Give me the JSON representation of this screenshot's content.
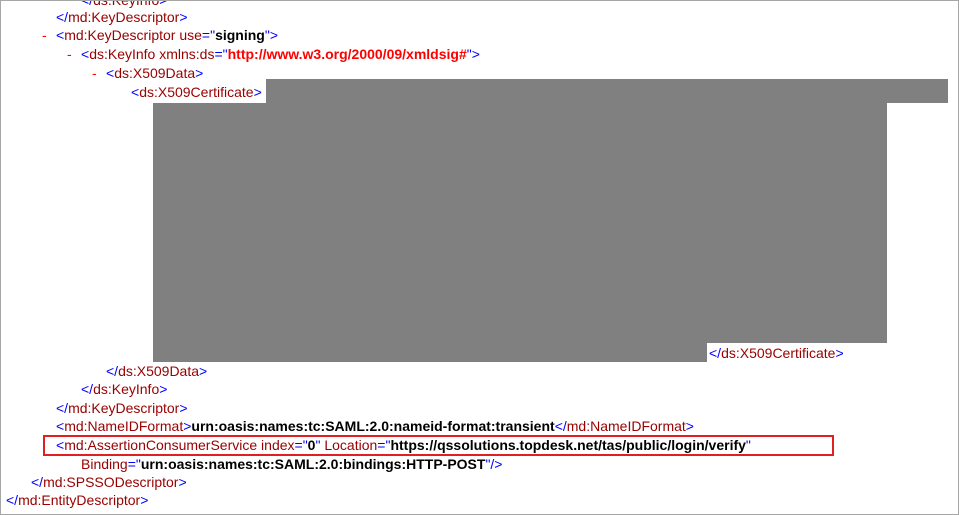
{
  "xml": {
    "lines": {
      "l0": {
        "close_tag": "ds:KeyInfo"
      },
      "l1": {
        "close_tag": "md:KeyDescriptor"
      },
      "l2": {
        "toggle": "-",
        "tag": "md:KeyDescriptor",
        "attr_name": "use",
        "attr_value": "signing"
      },
      "l3": {
        "toggle": "-",
        "tag": "ds:KeyInfo",
        "attr_name": "xmlns:ds",
        "attr_value": "http://www.w3.org/2000/09/xmldsig#"
      },
      "l4": {
        "toggle": "-",
        "tag": "ds:X509Data"
      },
      "l5": {
        "tag": "ds:X509Certificate"
      },
      "l6": {
        "close_tag": "ds:X509Certificate"
      },
      "l7": {
        "close_tag": "ds:X509Data"
      },
      "l8": {
        "close_tag": "ds:KeyInfo"
      },
      "l9": {
        "close_tag": "md:KeyDescriptor"
      },
      "l10": {
        "tag": "md:NameIDFormat",
        "text": "urn:oasis:names:tc:SAML:2.0:nameid-format:transient",
        "close_tag": "md:NameIDFormat"
      },
      "l11": {
        "tag": "md:AssertionConsumerService",
        "attr1_name": "index",
        "attr1_value": "0",
        "attr2_name": "Location",
        "attr2_value": "https://qssolutions.topdesk.net/tas/public/login/verify"
      },
      "l12": {
        "attr_name": "Binding",
        "attr_value": "urn:oasis:names:tc:SAML:2.0:bindings:HTTP-POST"
      },
      "l13": {
        "close_tag": "md:SPSSODescriptor"
      },
      "l14": {
        "close_tag": "md:EntityDescriptor"
      }
    }
  },
  "colors": {
    "markup": "#0000ff",
    "tag_name": "#990000",
    "value": "#000000",
    "toggle": "#ff0000",
    "redaction": "#808080",
    "highlight": "#e02020"
  }
}
